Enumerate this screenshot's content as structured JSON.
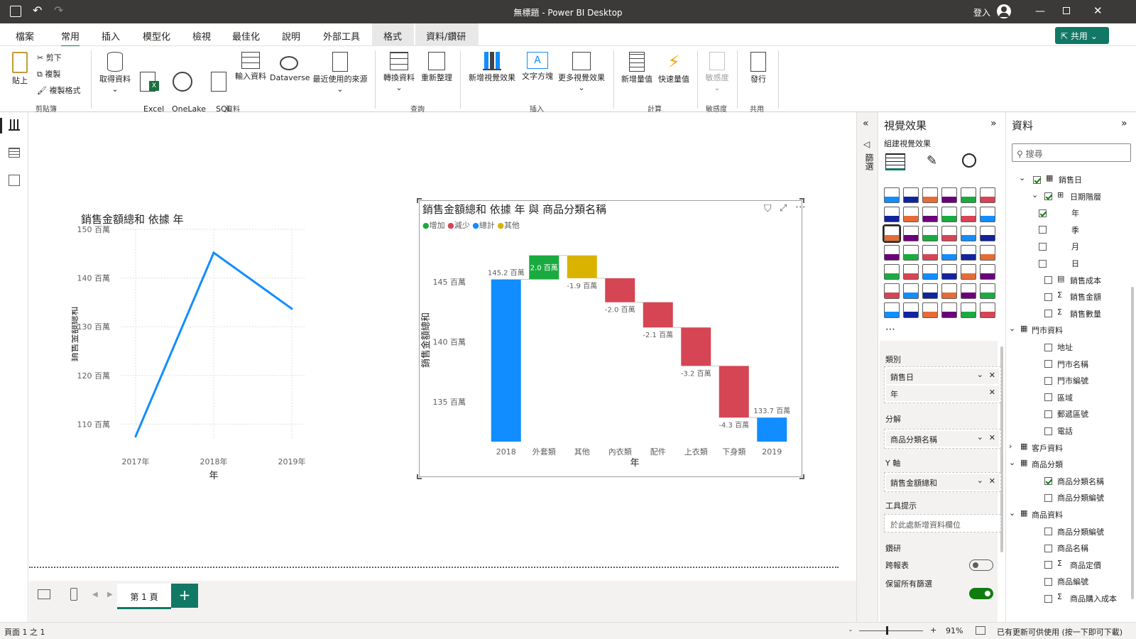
{
  "window": {
    "title": "無標題 - Power BI Desktop",
    "signin": "登入",
    "share": "共用"
  },
  "menu": [
    "檔案",
    "常用",
    "插入",
    "模型化",
    "檢視",
    "最佳化",
    "說明",
    "外部工具",
    "格式",
    "資料/鑽研"
  ],
  "ribbon": {
    "clipboard": {
      "paste": "貼上",
      "cut": "剪下",
      "copy": "複製",
      "format_painter": "複製格式",
      "group": "剪貼簿"
    },
    "data": {
      "get_data": "取得資料",
      "excel": "Excel\n活頁簿",
      "onelake": "OneLake\n資料中樞",
      "sql": "SQL\nServer",
      "enter": "輸入資料",
      "dataverse": "Dataverse",
      "recent": "最近使用的來源",
      "group": "資料"
    },
    "query": {
      "transform": "轉換資料",
      "refresh": "重新整理",
      "group": "查詢"
    },
    "insert": {
      "new_visual": "新增視覺效果",
      "textbox": "文字方塊",
      "more_visuals": "更多視覺效果",
      "group": "插入"
    },
    "calc": {
      "new_measure": "新增量值",
      "quick_measure": "快速量值",
      "group": "計算"
    },
    "sensitivity": {
      "label": "敏感度",
      "group": "敏感度"
    },
    "share": {
      "publish": "發行",
      "group": "共用"
    }
  },
  "line_chart": {
    "title": "銷售金額總和 依據 年",
    "xlabel": "年",
    "ylabel": "銷售金額總和",
    "ticks": [
      "150 百萬",
      "140 百萬",
      "130 百萬",
      "120 百萬",
      "110 百萬"
    ],
    "color": "#118dff"
  },
  "waterfall": {
    "title": "銷售金額總和 依據 年 與 商品分類名稱",
    "legend": [
      {
        "label": "增加",
        "color": "#1aab40"
      },
      {
        "label": "減少",
        "color": "#d64554"
      },
      {
        "label": "總計",
        "color": "#118dff"
      },
      {
        "label": "其他",
        "color": "#d9b300"
      }
    ],
    "xlabel": "年",
    "ylabel": "銷售金額總和",
    "ticks": [
      "145 百萬",
      "140 百萬",
      "135 百萬"
    ]
  },
  "chart_data": [
    {
      "type": "line",
      "title": "銷售金額總和 依據 年",
      "xlabel": "年",
      "ylabel": "銷售金額總和",
      "categories": [
        "2017年",
        "2018年",
        "2019年"
      ],
      "values": [
        107.5,
        145.2,
        133.7
      ],
      "ylim": [
        107,
        150
      ],
      "grid": true
    },
    {
      "type": "bar",
      "subtype": "waterfall",
      "title": "銷售金額總和 依據 年 與 商品分類名稱",
      "xlabel": "年",
      "ylabel": "銷售金額總和",
      "categories": [
        "2018",
        "外套類",
        "其他",
        "內衣類",
        "配件",
        "上衣類",
        "下身類",
        "2019"
      ],
      "values": [
        145.2,
        2.0,
        0.0,
        -1.9,
        -2.0,
        -2.1,
        -3.2,
        -4.3,
        133.7
      ],
      "bars": [
        {
          "category": "2018",
          "kind": "total",
          "value": 145.2,
          "label": "145.2 百萬"
        },
        {
          "category": "外套類",
          "kind": "increase",
          "value": 2.0,
          "label": "2.0 百萬"
        },
        {
          "category": "其他",
          "kind": "other",
          "value": -1.9,
          "label": "-1.9 百萬"
        },
        {
          "category": "內衣類",
          "kind": "decrease",
          "value": -2.0,
          "label": "-2.0 百萬"
        },
        {
          "category": "配件",
          "kind": "decrease",
          "value": -2.1,
          "label": "-2.1 百萬"
        },
        {
          "category": "上衣類",
          "kind": "decrease",
          "value": -3.2,
          "label": "-3.2 百萬"
        },
        {
          "category": "下身類",
          "kind": "decrease",
          "value": -4.3,
          "label": "-4.3 百萬"
        },
        {
          "category": "2019",
          "kind": "total",
          "value": 133.7,
          "label": "133.7 百萬"
        }
      ],
      "ylim": [
        131.7,
        148.6
      ],
      "legend_position": "top-left"
    }
  ],
  "viz_pane": {
    "title": "視覺效果",
    "subtitle": "組建視覺效果",
    "wells": {
      "category": "類別",
      "cat_field1": "銷售日",
      "cat_field2": "年",
      "breakdown": "分解",
      "breakdown_field": "商品分類名稱",
      "y": "Y 軸",
      "y_field": "銷售金額總和",
      "tooltip": "工具提示",
      "tooltip_placeholder": "於此處新增資料欄位",
      "drill": "鑽研",
      "cross_report": "跨報表",
      "keep_filters": "保留所有篩選"
    },
    "filters_label": "篩選"
  },
  "data_pane": {
    "title": "資料",
    "search_placeholder": "搜尋",
    "items": [
      {
        "label": "銷售日",
        "indent": 1,
        "checked": true,
        "expand": "v",
        "icon": "calendar"
      },
      {
        "label": "日期階層",
        "indent": 2,
        "checked": true,
        "expand": "v",
        "icon": "hier"
      },
      {
        "label": "年",
        "indent": 3,
        "checked": true,
        "expand": "",
        "icon": ""
      },
      {
        "label": "季",
        "indent": 3,
        "checked": false,
        "expand": "",
        "icon": ""
      },
      {
        "label": "月",
        "indent": 3,
        "checked": false,
        "expand": "",
        "icon": ""
      },
      {
        "label": "日",
        "indent": 3,
        "checked": false,
        "expand": "",
        "icon": ""
      },
      {
        "label": "銷售成本",
        "indent": 2,
        "checked": false,
        "expand": "",
        "icon": "calc"
      },
      {
        "label": "銷售金額",
        "indent": 2,
        "checked": false,
        "expand": "",
        "icon": "sigma"
      },
      {
        "label": "銷售數量",
        "indent": 2,
        "checked": false,
        "expand": "",
        "icon": "sigma"
      },
      {
        "label": "門市資料",
        "indent": 0,
        "checked": null,
        "expand": "v",
        "icon": "table"
      },
      {
        "label": "地址",
        "indent": 2,
        "checked": false,
        "expand": "",
        "icon": ""
      },
      {
        "label": "門市名稱",
        "indent": 2,
        "checked": false,
        "expand": "",
        "icon": ""
      },
      {
        "label": "門市編號",
        "indent": 2,
        "checked": false,
        "expand": "",
        "icon": ""
      },
      {
        "label": "區域",
        "indent": 2,
        "checked": false,
        "expand": "",
        "icon": ""
      },
      {
        "label": "郵遞區號",
        "indent": 2,
        "checked": false,
        "expand": "",
        "icon": ""
      },
      {
        "label": "電話",
        "indent": 2,
        "checked": false,
        "expand": "",
        "icon": ""
      },
      {
        "label": "客戶資料",
        "indent": 0,
        "checked": null,
        "expand": ">",
        "icon": "table"
      },
      {
        "label": "商品分類",
        "indent": 0,
        "checked": null,
        "expand": "v",
        "icon": "table"
      },
      {
        "label": "商品分類名稱",
        "indent": 2,
        "checked": true,
        "expand": "",
        "icon": ""
      },
      {
        "label": "商品分類編號",
        "indent": 2,
        "checked": false,
        "expand": "",
        "icon": ""
      },
      {
        "label": "商品資料",
        "indent": 0,
        "checked": null,
        "expand": "v",
        "icon": "table"
      },
      {
        "label": "商品分類編號",
        "indent": 2,
        "checked": false,
        "expand": "",
        "icon": ""
      },
      {
        "label": "商品名稱",
        "indent": 2,
        "checked": false,
        "expand": "",
        "icon": ""
      },
      {
        "label": "商品定價",
        "indent": 2,
        "checked": false,
        "expand": "",
        "icon": "sigma"
      },
      {
        "label": "商品編號",
        "indent": 2,
        "checked": false,
        "expand": "",
        "icon": ""
      },
      {
        "label": "商品購入成本",
        "indent": 2,
        "checked": false,
        "expand": "",
        "icon": "sigma"
      }
    ]
  },
  "pages": {
    "tab": "第 1 頁",
    "add": "+"
  },
  "status": {
    "page": "頁面 1 之 1",
    "zoom": "91%",
    "update": "已有更新可供使用 (按一下即可下載)",
    "minus": "-",
    "plus": "+"
  }
}
